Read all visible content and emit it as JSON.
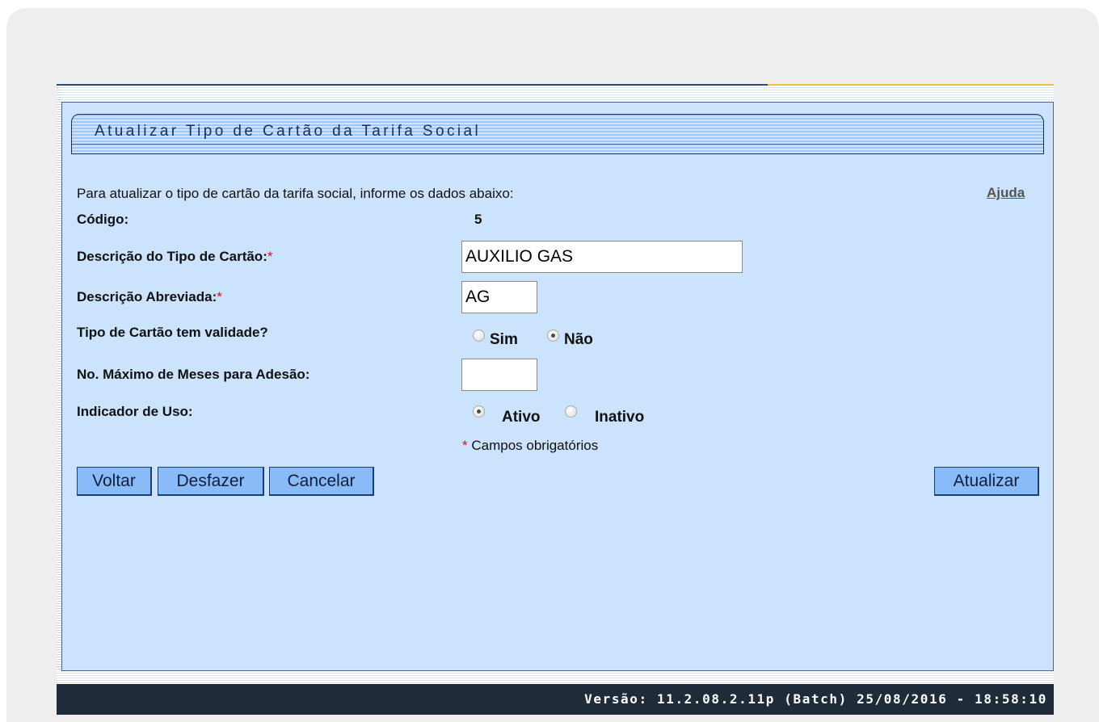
{
  "page": {
    "title": "Atualizar Tipo de Cartão da Tarifa Social",
    "instructions": "Para atualizar o tipo de cartão da tarifa social, informe os dados abaixo:",
    "help_link": "Ajuda"
  },
  "form": {
    "codigo": {
      "label": "Código:",
      "value": "5"
    },
    "descricao": {
      "label": "Descrição do Tipo de Cartão:",
      "required_mark": "*",
      "value": "AUXILIO GAS"
    },
    "abreviada": {
      "label": "Descrição Abreviada:",
      "required_mark": "*",
      "value": "AG"
    },
    "validade": {
      "label": "Tipo de Cartão tem validade?",
      "options": [
        {
          "label": "Sim",
          "checked": false
        },
        {
          "label": "Não",
          "checked": true
        }
      ]
    },
    "meses": {
      "label": "No. Máximo de Meses para Adesão:",
      "value": ""
    },
    "uso": {
      "label": "Indicador de Uso:",
      "options": [
        {
          "label": "Ativo",
          "checked": true
        },
        {
          "label": "Inativo",
          "checked": false
        }
      ]
    },
    "required_note_mark": "*",
    "required_note": "Campos obrigatórios"
  },
  "buttons": {
    "voltar": "Voltar",
    "desfazer": "Desfazer",
    "cancelar": "Cancelar",
    "atualizar": "Atualizar"
  },
  "footer": {
    "version": "Versão: 11.2.08.2.11p (Batch) 25/08/2016 - 18:58:10"
  },
  "colors": {
    "panel_bg": "#cbe3fd",
    "button_bg": "#88bbf8",
    "footer_bg": "#1f2b38",
    "required": "#dd1111"
  }
}
